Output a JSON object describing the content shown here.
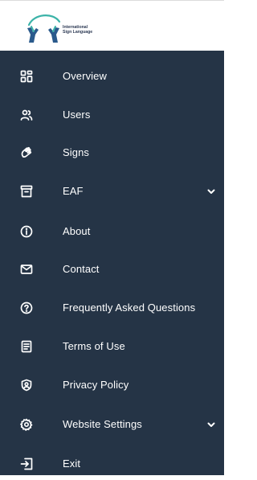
{
  "brand": {
    "line1": "International",
    "line2": "Sign Language",
    "colors": {
      "primary": "#3bb3a8",
      "secondary": "#2a5a8c",
      "sidebar": "#253446",
      "text": "#ffffff"
    }
  },
  "sidebar": {
    "items": [
      {
        "label": "Overview",
        "icon": "grid-icon"
      },
      {
        "label": "Users",
        "icon": "users-icon"
      },
      {
        "label": "Signs",
        "icon": "hand-icon"
      },
      {
        "label": "EAF",
        "icon": "archive-icon",
        "expandable": true
      },
      {
        "label": "About",
        "icon": "info-icon"
      },
      {
        "label": "Contact",
        "icon": "mail-icon"
      },
      {
        "label": "Frequently Asked Questions",
        "icon": "help-circle-icon"
      },
      {
        "label": "Terms of Use",
        "icon": "document-icon"
      },
      {
        "label": "Privacy Policy",
        "icon": "shield-user-icon"
      },
      {
        "label": "Website Settings",
        "icon": "gear-icon",
        "expandable": true
      },
      {
        "label": "Exit",
        "icon": "exit-icon"
      }
    ]
  }
}
